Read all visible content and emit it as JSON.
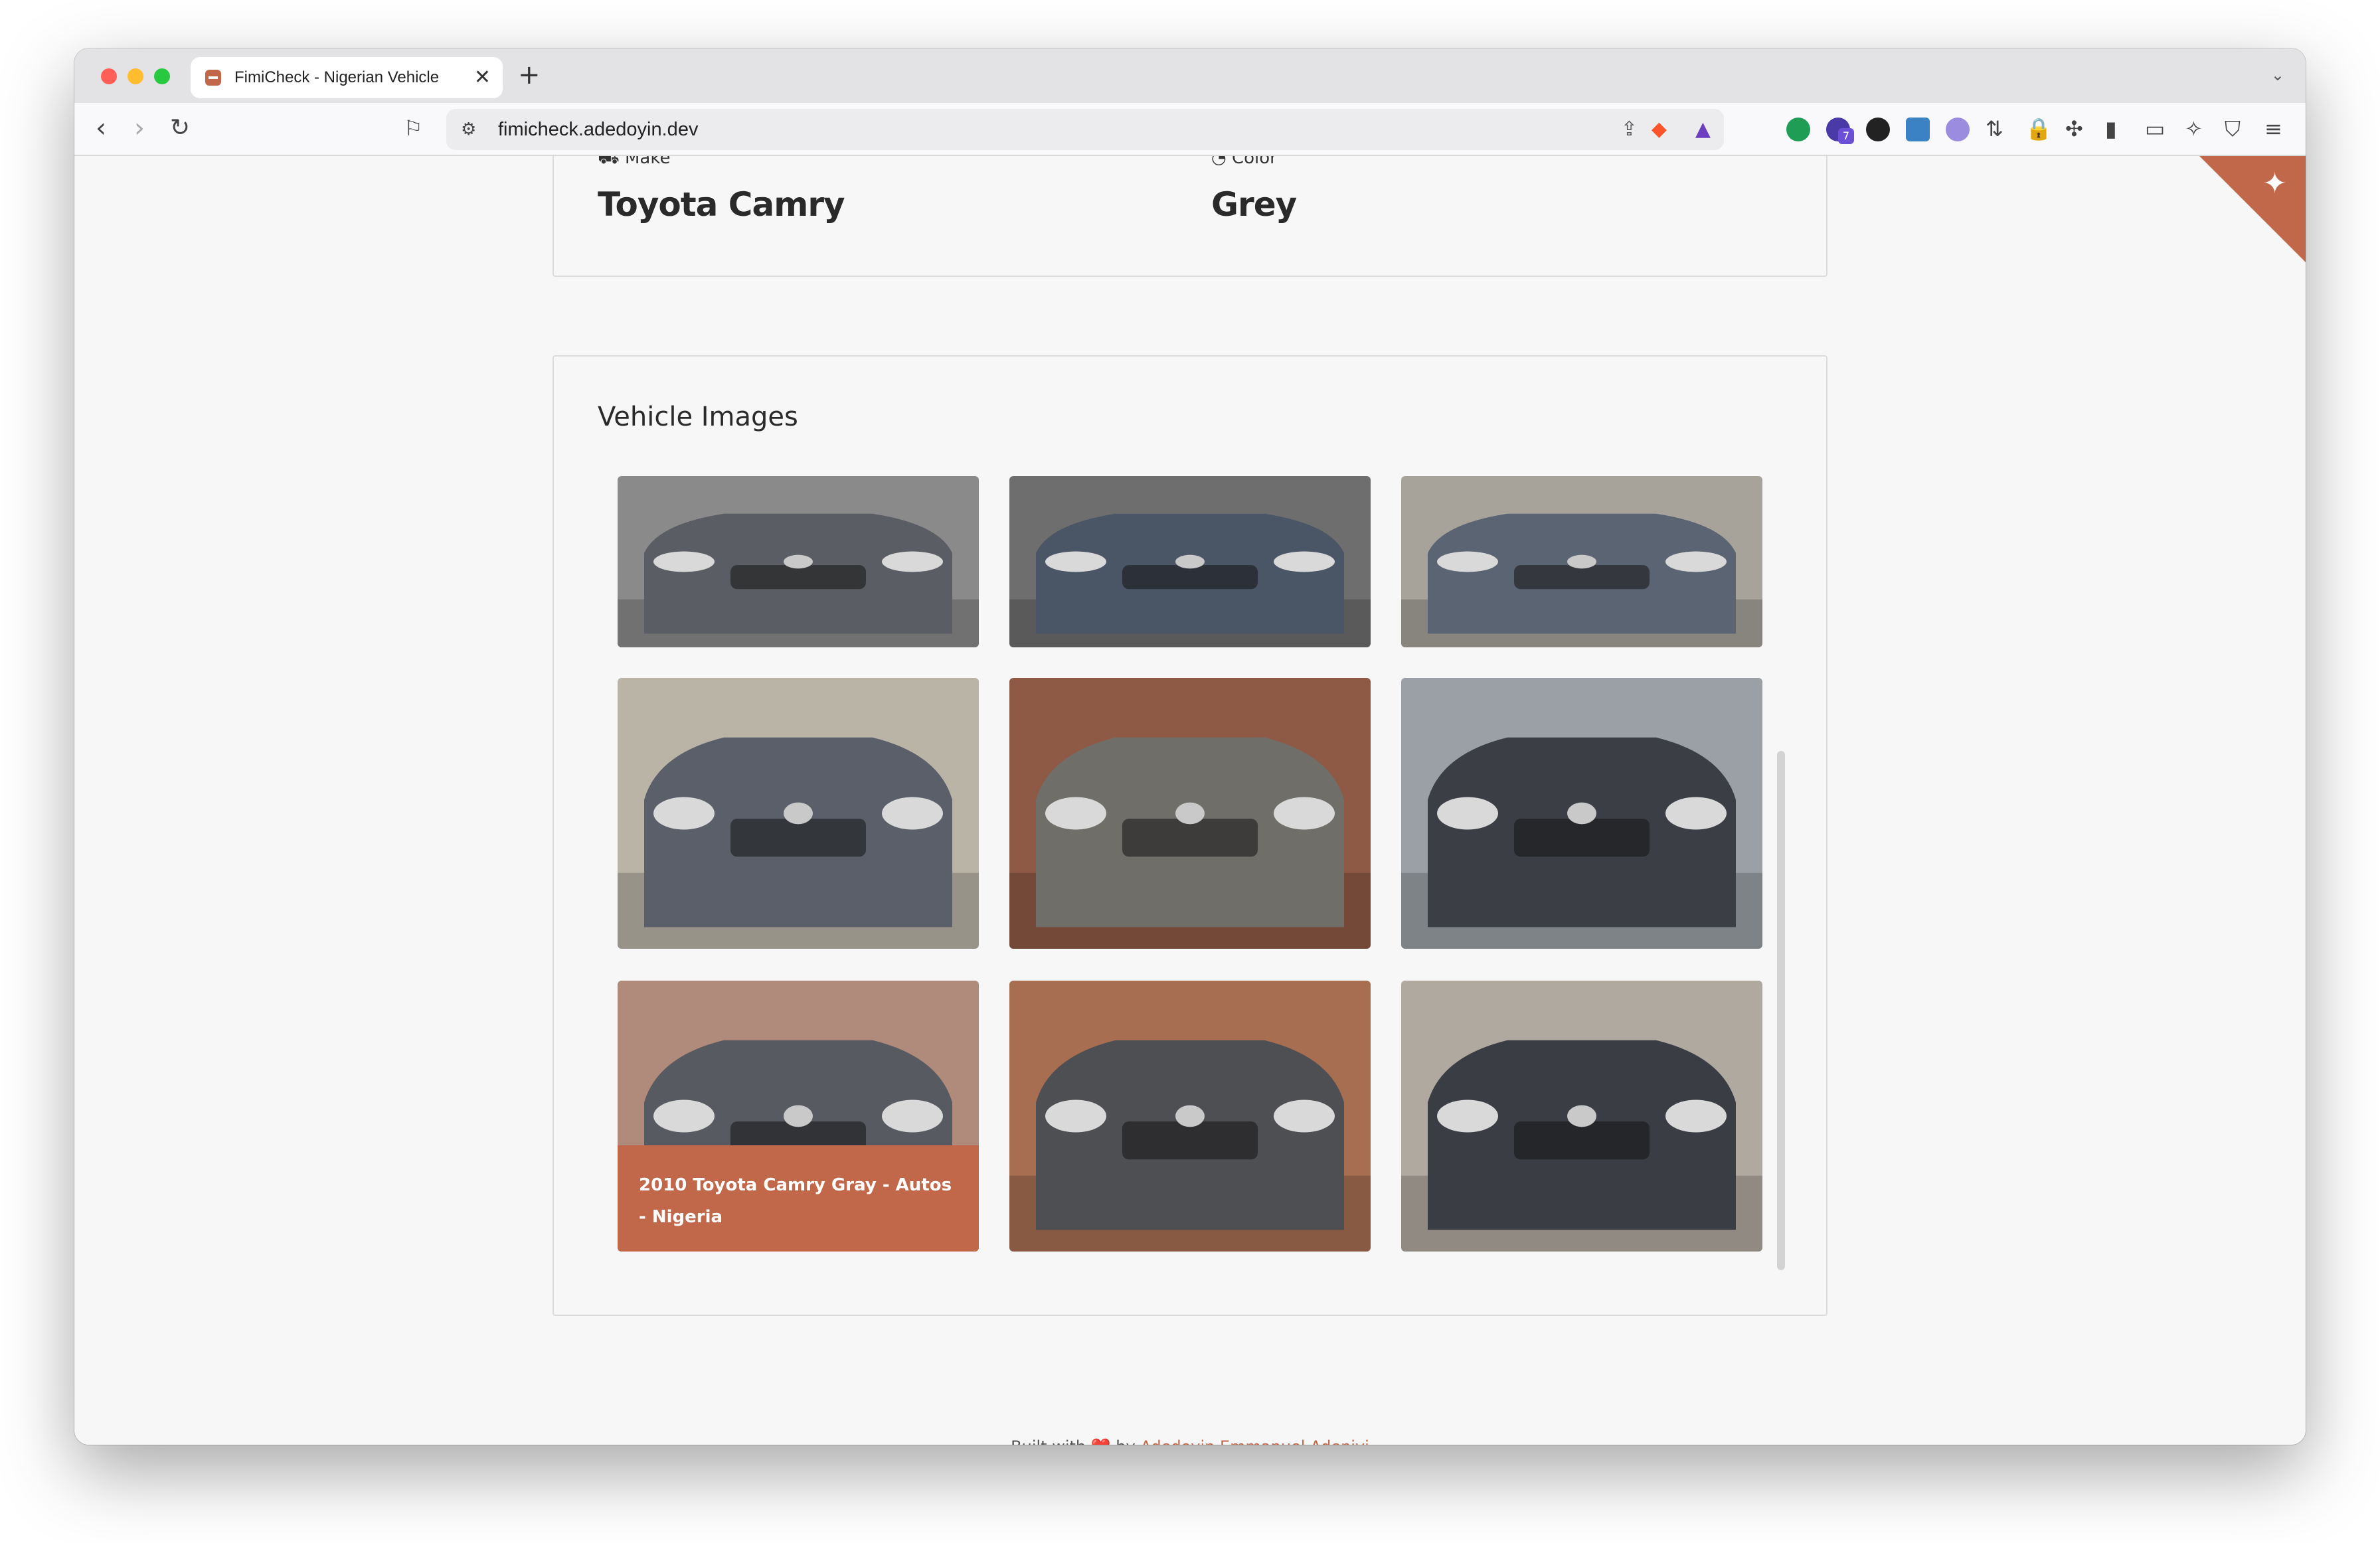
{
  "browser": {
    "tab_title": "FimiCheck - Nigerian Vehicle",
    "tab_close": "✕",
    "new_tab": "+",
    "url": "fimicheck.adedoyin.dev",
    "back": "‹",
    "forward": "›",
    "reload": "↻",
    "ext_badge": "7"
  },
  "vehicle": {
    "make_label": "Make",
    "make_value": "Toyota Camry",
    "color_label": "Color",
    "color_value": "Grey"
  },
  "images_section": {
    "title": "Vehicle Images",
    "caption": "2010 Toyota Camry Gray - Autos - Nigeria",
    "images": [
      {
        "icon": "car-front-photo",
        "body": "#5a5d63",
        "bg": "#8a8a8a"
      },
      {
        "icon": "car-front-photo",
        "body": "#4a5566",
        "bg": "#6e6e6e"
      },
      {
        "icon": "car-rear-photo",
        "body": "#5b6472",
        "bg": "#a7a39b"
      },
      {
        "icon": "car-side-photo",
        "body": "#5a5f69",
        "bg": "#b9b4a6"
      },
      {
        "icon": "car-front-photo",
        "body": "#6f6e69",
        "bg": "#8f5a45"
      },
      {
        "icon": "car-rear-photo",
        "body": "#3b3e45",
        "bg": "#9aa0a5"
      },
      {
        "icon": "car-front-photo",
        "body": "#575a60",
        "bg": "#b08a7a"
      },
      {
        "icon": "car-engine-photo",
        "body": "#4e4f52",
        "bg": "#a76e52"
      },
      {
        "icon": "car-front-photo",
        "body": "#3a3d44",
        "bg": "#b0a9a0"
      }
    ]
  },
  "footer": {
    "prefix": "Built with",
    "heart": "❤️",
    "by": "by",
    "author": "Adedoyin Emmanuel Adeniyi"
  }
}
